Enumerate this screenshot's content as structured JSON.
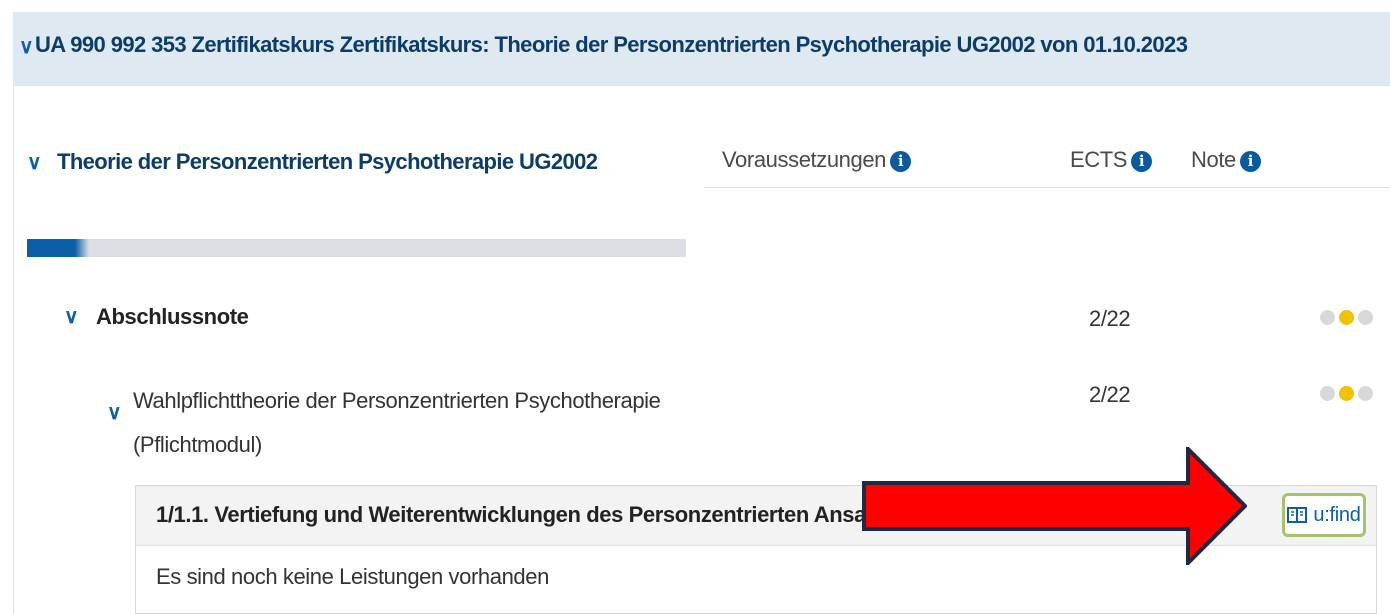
{
  "header": {
    "title": "UA 990 992 353 Zertifikatskurs Zertifikatskurs: Theorie der Personzentrierten Psychotherapie UG2002 von 01.10.2023"
  },
  "section": {
    "title": "Theorie der Personzentrierten Psychotherapie UG2002",
    "columns": {
      "voraussetzungen": "Voraussetzungen",
      "ects": "ECTS",
      "note": "Note"
    },
    "progress_percent": 7.3
  },
  "rows": [
    {
      "label": "Abschlussnote",
      "ects": "2/22",
      "dots_active_index": 1
    },
    {
      "label_line1": "Wahlpflichttheorie der Personzentrierten Psychotherapie",
      "label_line2": "(Pflichtmodul)",
      "ects": "2/22",
      "dots_active_index": 1
    }
  ],
  "course": {
    "title": "1/1.1. Vertiefung und Weiterentwicklungen des Personzentrierten Ansatzes",
    "empty_message": "Es sind noch keine Leistungen vorhanden",
    "ufind_label": "u:find"
  },
  "icons": {
    "info": "info-circle-icon",
    "chevron": "chevron-down-icon",
    "ufind": "book-icon",
    "annotation": "red-arrow-icon"
  },
  "colors": {
    "header_bg": "#dfe9f1",
    "accent_blue": "#0b5fa8",
    "active_dot": "#f2c200",
    "inactive_dot": "#d8d8d8",
    "ufind_border": "#a6c26a",
    "arrow_fill": "#ff0000"
  }
}
